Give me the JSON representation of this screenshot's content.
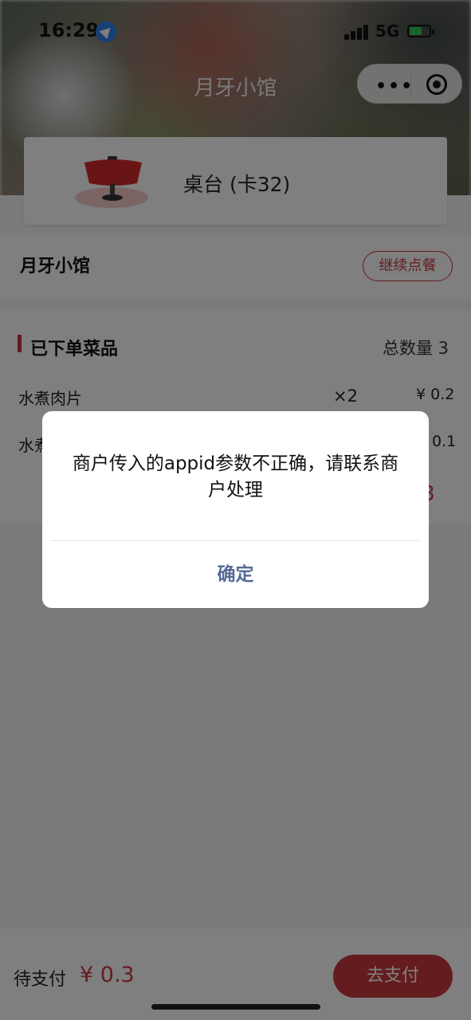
{
  "status_bar": {
    "time": "16:29",
    "network": "5G"
  },
  "nav": {
    "title": "月牙小馆"
  },
  "table": {
    "label": "桌台 (卡32)"
  },
  "shop": {
    "name": "月牙小馆",
    "continue_label": "继续点餐"
  },
  "order": {
    "section_title": "已下单菜品",
    "total_qty_label": "总数量 3",
    "items": [
      {
        "name": "水煮肉片",
        "qty": "×2",
        "price": "¥ 0.2"
      },
      {
        "name": "水煮",
        "qty": "",
        "price": "0.1"
      }
    ],
    "total_amount_partial": ".3"
  },
  "footer": {
    "pending_label": "待支付",
    "pending_amount": "¥ 0.3",
    "pay_label": "去支付"
  },
  "dialog": {
    "message": "商户传入的appid参数不正确，请联系商户处理",
    "confirm_label": "确定"
  },
  "colors": {
    "accent": "#c9393c",
    "dialog_button": "#576b95",
    "mask": "rgba(0,0,0,0.5)"
  }
}
